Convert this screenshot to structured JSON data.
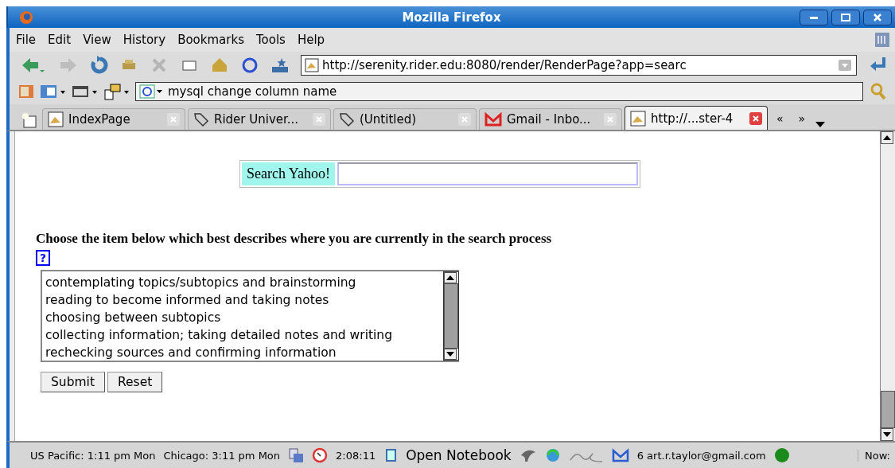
{
  "window": {
    "title": "Mozilla Firefox"
  },
  "menu": [
    "File",
    "Edit",
    "View",
    "History",
    "Bookmarks",
    "Tools",
    "Help"
  ],
  "address": {
    "value": "http://serenity.rider.edu:8080/render/RenderPage?app=searc"
  },
  "search": {
    "value": "mysql change column name"
  },
  "tabs": [
    {
      "label": "IndexPage",
      "kind": "page",
      "selected": false
    },
    {
      "label": "Rider Univer...",
      "kind": "tag",
      "selected": false
    },
    {
      "label": "(Untitled)",
      "kind": "tag",
      "selected": false
    },
    {
      "label": "Gmail - Inbo...",
      "kind": "mail",
      "selected": false
    },
    {
      "label": "http://...ster-4",
      "kind": "page",
      "selected": true
    }
  ],
  "tab_scroll": [
    "«",
    "»"
  ],
  "page": {
    "search_label": "Search Yahoo!",
    "question": "Choose the item below which best describes where you are currently in the search process",
    "help": "?",
    "options": [
      "contemplating topics/subtopics and brainstorming",
      "reading to become informed and taking notes",
      "choosing between subtopics",
      "collecting information; taking detailed notes and writing",
      "rechecking sources and confirming information"
    ],
    "buttons": [
      "Submit",
      "Reset"
    ]
  },
  "status_bar": {
    "clock_pacific": "US Pacific: 1:11 pm Mon",
    "clock_chicago": "Chicago: 3:11 pm Mon",
    "timer": "2:08:11",
    "notebook": "Open Notebook",
    "gmail": "6 art.r.taylor@gmail.com",
    "now": "Now:"
  }
}
